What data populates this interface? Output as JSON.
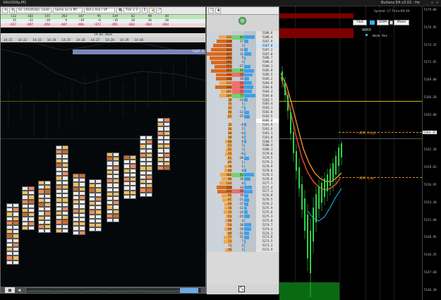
{
  "window": {
    "title": "XAUUSDp,M1",
    "ea_title": "Buttons EA v3.02 - Ho"
  },
  "footprint": {
    "toolbar": {
      "symbol": "GC (XAU/USD, Gold)",
      "mode": "Same as in MT",
      "display": "Bid x Ask / VP",
      "tick": "Tick x 3"
    },
    "stats_rows": [
      [
        "112",
        "102",
        "155",
        "263",
        "167",
        "95",
        "139",
        "62",
        "98",
        "44"
      ],
      [
        "35",
        "-22",
        "-19",
        "9",
        "-19",
        "-6",
        "-19",
        "28",
        "36",
        "20"
      ],
      [
        "-817",
        "-897",
        "-856",
        "-847",
        "-866",
        "-872",
        "-891",
        "-863",
        "-864",
        "-844"
      ]
    ],
    "date": "24.02.2026",
    "times": [
      "14:21",
      "14:22",
      "14:23",
      "14:24",
      "14:25",
      "14:26",
      "14:27",
      "14:28",
      "14:29",
      "14:30"
    ],
    "price_tag": "5187.6"
  },
  "ladder": {
    "rows": [
      {
        "vol": "",
        "delta": "",
        "cvd": "",
        "price": "5188.6"
      },
      {
        "vol": "116",
        "delta": "44",
        "cvd": "",
        "price": "5188.4"
      },
      {
        "vol": "139",
        "delta": "17",
        "cvd": "",
        "price": "5187.9"
      },
      {
        "vol": "165",
        "delta": "3",
        "cvd": "",
        "price": "5187.6"
      },
      {
        "vol": "184",
        "delta": "14",
        "cvd": "",
        "price": "5187.2"
      },
      {
        "vol": "357",
        "delta": "31",
        "cvd": "",
        "price": "5187.0"
      },
      {
        "vol": "199",
        "delta": "5",
        "cvd": "",
        "price": "5186.7"
      },
      {
        "vol": "185",
        "delta": "3",
        "cvd": "",
        "price": "5186.4"
      },
      {
        "vol": "153",
        "delta": "-27",
        "cvd": "",
        "price": "5186.1"
      },
      {
        "vol": "185",
        "delta": "43",
        "cvd": "",
        "price": "5185.8"
      },
      {
        "vol": "140",
        "delta": "-36",
        "cvd": "",
        "price": "5185.5"
      },
      {
        "vol": "140",
        "delta": "20",
        "cvd": "",
        "price": "5185.2"
      },
      {
        "vol": "113",
        "delta": "-33",
        "cvd": "",
        "price": "5184.9"
      },
      {
        "vol": "146",
        "delta": "-38",
        "cvd": "",
        "price": "5184.6"
      },
      {
        "vol": "101",
        "delta": "-33",
        "cvd": "",
        "price": "5184.3"
      },
      {
        "vol": "109",
        "delta": "77",
        "cvd": "",
        "price": "5184.0"
      },
      {
        "vol": "30",
        "delta": "-14",
        "cvd": "",
        "price": "5183.7"
      },
      {
        "vol": "33",
        "delta": "1",
        "cvd": "",
        "price": "5183.4"
      },
      {
        "vol": "35",
        "delta": "-7",
        "cvd": "",
        "price": "5183.1"
      },
      {
        "vol": "40",
        "delta": "-22",
        "cvd": "",
        "price": "5182.8"
      },
      {
        "vol": "43",
        "delta": "-25",
        "cvd": "",
        "price": "5182.5"
      },
      {
        "vol": "",
        "delta": "",
        "cvd": "",
        "price": "5182.2"
      },
      {
        "vol": "32",
        "delta": "-8",
        "cvd": "",
        "price": "5181.9"
      },
      {
        "vol": "36",
        "delta": "2",
        "cvd": "",
        "price": "5181.6"
      },
      {
        "vol": "38",
        "delta": "-6",
        "cvd": "",
        "price": "5181.3"
      },
      {
        "vol": "39",
        "delta": "6",
        "cvd": "",
        "price": "5181.0"
      },
      {
        "vol": "60",
        "delta": "8",
        "cvd": "",
        "price": "5180.7"
      },
      {
        "vol": "52",
        "delta": "3",
        "cvd": "",
        "price": "5180.4"
      },
      {
        "vol": "55",
        "delta": "3",
        "cvd": "",
        "price": "5180.1"
      },
      {
        "vol": "59",
        "delta": "-6",
        "cvd": "",
        "price": "5179.8"
      },
      {
        "vol": "41",
        "delta": "-20",
        "cvd": "",
        "price": "5179.5"
      },
      {
        "vol": "45",
        "delta": "1",
        "cvd": "",
        "price": "5179.2"
      },
      {
        "vol": "70",
        "delta": "2",
        "cvd": "",
        "price": "5178.9"
      },
      {
        "vol": "68",
        "delta": "8",
        "cvd": "",
        "price": "5178.6"
      },
      {
        "vol": "106",
        "delta": "43",
        "cvd": "",
        "price": "5178.3"
      },
      {
        "vol": "96",
        "delta": "26",
        "cvd": "",
        "price": "5178.0"
      },
      {
        "vol": "114",
        "delta": "6",
        "cvd": "",
        "price": "5177.7"
      },
      {
        "vol": "138",
        "delta": "34",
        "cvd": "",
        "price": "5177.4"
      },
      {
        "vol": "133",
        "delta": "-36",
        "cvd": "",
        "price": "5177.1"
      },
      {
        "vol": "95",
        "delta": "19",
        "cvd": "",
        "price": "5176.8"
      },
      {
        "vol": "87",
        "delta": "-21",
        "cvd": "",
        "price": "5176.5"
      },
      {
        "vol": "69",
        "delta": "-17",
        "cvd": "",
        "price": "5176.2"
      },
      {
        "vol": "70",
        "delta": "-12",
        "cvd": "",
        "price": "5175.9"
      },
      {
        "vol": "72",
        "delta": "-14",
        "cvd": "",
        "price": "5175.6"
      },
      {
        "vol": "53",
        "delta": "-25",
        "cvd": "",
        "price": "5175.3"
      },
      {
        "vol": "60",
        "delta": "4",
        "cvd": "",
        "price": "5175.0"
      },
      {
        "vol": "54",
        "delta": "30",
        "cvd": "",
        "price": "5174.7"
      },
      {
        "vol": "69",
        "delta": "-29",
        "cvd": "",
        "price": "5174.4"
      },
      {
        "vol": "49",
        "delta": "-21",
        "cvd": "",
        "price": "5174.1"
      },
      {
        "vol": "77",
        "delta": "21",
        "cvd": "",
        "price": "5173.8"
      },
      {
        "vol": "73",
        "delta": "7",
        "cvd": "",
        "price": "5173.5"
      },
      {
        "vol": "11",
        "delta": "3",
        "cvd": "",
        "price": "5173.2"
      },
      {
        "vol": "59",
        "delta": "3",
        "cvd": "",
        "price": "5172.9"
      }
    ]
  },
  "ea": {
    "btn1": "T&S",
    "btn2": "DOM",
    "btn3": "Moon",
    "label_wh": "WH3",
    "label_weak": "Weak Res",
    "spread": "Spread: 17  Time:09:39"
  },
  "levels": {
    "adr_high": "ADR High",
    "adr_low": "ADR Low"
  },
  "price_axis": [
    "5179.00",
    "5176.95",
    "5174.35",
    "5171.65",
    "5169.00",
    "5166.30",
    "5165.00",
    "5164.35",
    "5162.30",
    "5159.65",
    "5156.95",
    "5154.30",
    "5151.60",
    "5148.95",
    "5146.35",
    "5147.60",
    "5146.30"
  ],
  "colors": {
    "ask_bar": "#f0a64a",
    "bid_bar": "#d9691f",
    "delta_pos": "#6ed36e",
    "delta_neg": "#f07070",
    "ema_red": "#e0402a",
    "ema_orange": "#f09030",
    "ema_cyan": "#2ab6e8",
    "vwap_green": "#2a8a55"
  }
}
